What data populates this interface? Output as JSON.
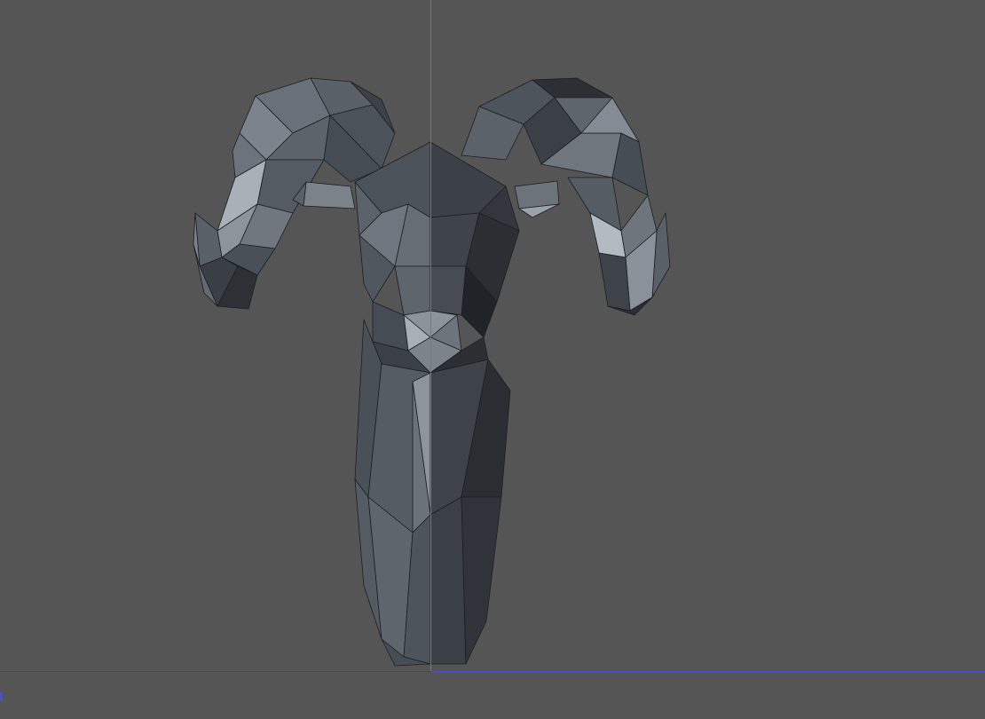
{
  "viewport": {
    "background_color": "#555555",
    "model_name_icon": "ram-head-lowpoly-model-icon"
  },
  "colors": {
    "y_axis": "#2fa84a",
    "x_axis": "#4b4fd0",
    "mesh_dark": "#2a2e32",
    "mesh_mid": "#4a5058",
    "mesh_light": "#8a929c",
    "edge": "#1b1e21"
  }
}
